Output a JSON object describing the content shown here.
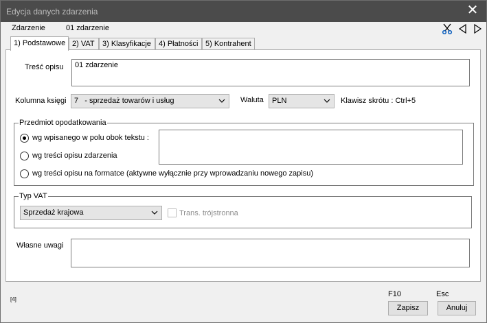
{
  "window": {
    "title": "Edycja danych zdarzenia",
    "close_glyph": "✕"
  },
  "header": {
    "label": "Zdarzenie",
    "value": "01 zdarzenie",
    "icons": [
      "scissors-icon",
      "prev-icon",
      "next-icon"
    ]
  },
  "tabs": [
    {
      "label": "1) Podstawowe",
      "active": true
    },
    {
      "label": "2) VAT"
    },
    {
      "label": "3) Klasyfikacje"
    },
    {
      "label": "4) Płatności"
    },
    {
      "label": "5) Kontrahent"
    }
  ],
  "form": {
    "description": {
      "label": "Treść opisu",
      "value": "01 zdarzenie"
    },
    "column": {
      "label": "Kolumna księgi",
      "value": "7   - sprzedaż towarów i usług"
    },
    "currency": {
      "label": "Waluta",
      "value": "PLN"
    },
    "shortcut": "Klawisz skrótu : Ctrl+5",
    "taxation": {
      "legend": "Przedmiot opodatkowania",
      "options": [
        {
          "label": "wg wpisanego w polu obok tekstu :",
          "selected": true
        },
        {
          "label": "wg treści opisu zdarzenia",
          "selected": false
        },
        {
          "label": "wg treści opisu na formatce (aktywne wyłącznie przy wprowadzaniu nowego zapisu)",
          "selected": false
        }
      ],
      "text_value": ""
    },
    "vat_type": {
      "legend": "Typ VAT",
      "value": "Sprzedaż krajowa",
      "triangular_label": "Trans. trójstronna",
      "triangular_checked": false
    },
    "notes": {
      "label": "Własne uwagi",
      "value": ""
    }
  },
  "footer": {
    "page_indicator": "[4]",
    "save": {
      "shortcut": "F10",
      "label": "Zapisz"
    },
    "cancel": {
      "shortcut": "Esc",
      "label": "Anuluj"
    }
  },
  "colors": {
    "titlebar": "#4b4b4b",
    "accent_icon": "#1565c0"
  }
}
